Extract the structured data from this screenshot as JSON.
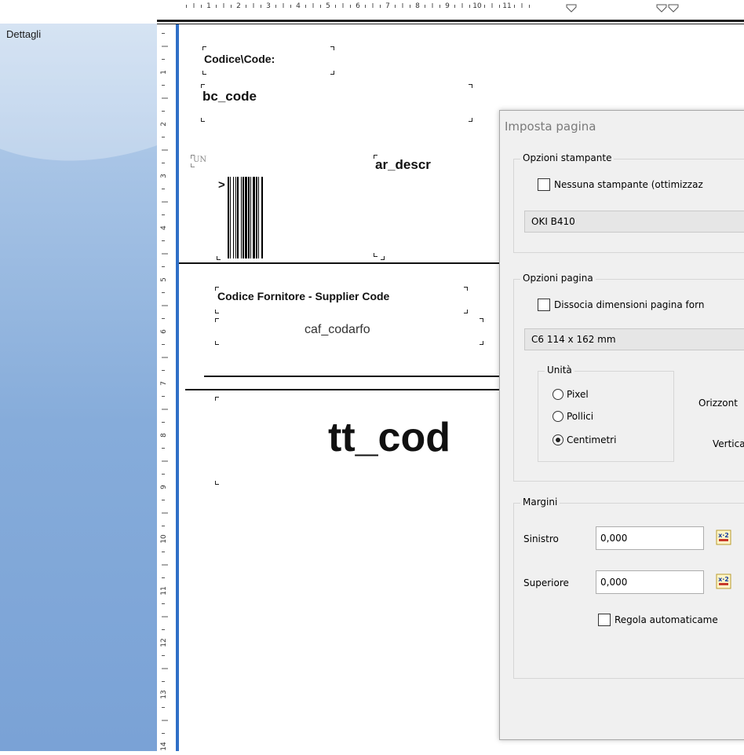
{
  "band_panel": {
    "label": "Dettagli"
  },
  "top_ruler": {
    "ticks": [
      "1",
      "2",
      "3",
      "4",
      "5",
      "6",
      "7",
      "8",
      "9",
      "10",
      "11"
    ]
  },
  "vertical_ruler": {
    "ticks": [
      "1",
      "2",
      "3",
      "4",
      "5",
      "6",
      "7",
      "8",
      "9",
      "10",
      "11",
      "12",
      "13",
      "14"
    ]
  },
  "report": {
    "code_label": "Codice\\Code:",
    "bc_code": "bc_code",
    "un_label": "UN",
    "barcode_prefix": ">",
    "ar_descr": "ar_descr",
    "supplier_label": "Codice Fornitore - Supplier Code",
    "caf_codarfo": "caf_codarfo",
    "tt_cod": "tt_cod"
  },
  "dialog": {
    "title": "Imposta pagina",
    "printer_group": {
      "title": "Opzioni stampante",
      "no_printer_label": "Nessuna stampante (ottimizzaz",
      "no_printer_checked": false,
      "printer_value": "OKI B410"
    },
    "page_group": {
      "title": "Opzioni pagina",
      "dissociate_label": "Dissocia dimensioni pagina forn",
      "dissociate_checked": false,
      "page_size_value": "C6 114 x 162 mm",
      "units_title": "Unità",
      "unit_pixel": "Pixel",
      "unit_inches": "Pollici",
      "unit_cm": "Centimetri",
      "selected_unit": "Centimetri",
      "horizontal_label": "Orizzont",
      "vertical_label": "Vertical"
    },
    "margins_group": {
      "title": "Margini",
      "left_label": "Sinistro",
      "left_value": "0,000",
      "top_label": "Superiore",
      "top_value": "0,000",
      "auto_label": "Regola automaticame",
      "auto_checked": false
    }
  },
  "colors": {
    "band_gradient_top": "#c6d9ef",
    "band_gradient_bottom": "#7aa2d6",
    "ruler_edge": "#2f6fc7"
  }
}
